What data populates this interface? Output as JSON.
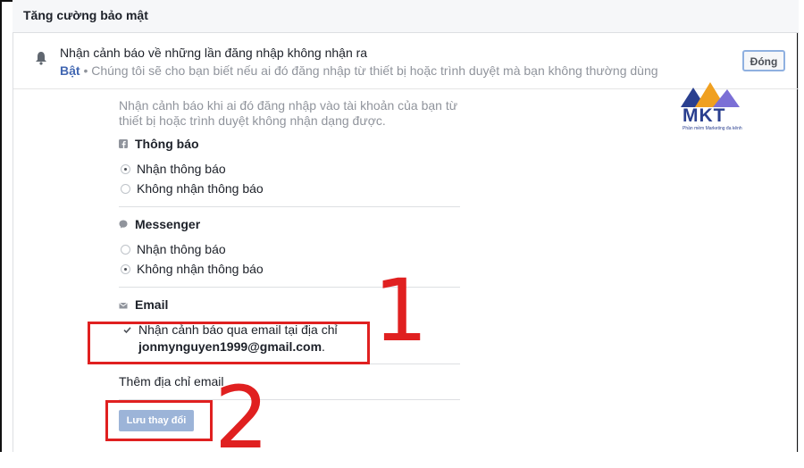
{
  "header": {
    "title": "Tăng cường bảo mật"
  },
  "alert": {
    "title": "Nhận cảnh báo về những lần đăng nhập không nhận ra",
    "status": "Bật",
    "separator": "•",
    "summary": "Chúng tôi sẽ cho bạn biết nếu ai đó đăng nhập từ thiết bị hoặc trình duyệt mà bạn không thường dùng",
    "close_label": "Đóng"
  },
  "description": "Nhận cảnh báo khi ai đó đăng nhập vào tài khoản của bạn từ thiết bị hoặc trình duyệt không nhận dạng được.",
  "notifications": {
    "title": "Thông báo",
    "options": [
      "Nhận thông báo",
      "Không nhận thông báo"
    ],
    "selected": 0
  },
  "messenger": {
    "title": "Messenger",
    "options": [
      "Nhận thông báo",
      "Không nhận thông báo"
    ],
    "selected": 1
  },
  "email": {
    "title": "Email",
    "checkbox_label": "Nhận cảnh báo qua email tại địa chỉ",
    "address": "jonmynguyen1999@gmail.com",
    "address_suffix": ".",
    "checked": true,
    "add_link": "Thêm địa chỉ email"
  },
  "save_label": "Lưu thay đổi",
  "annotations": {
    "step1": "1",
    "step2": "2"
  },
  "logo": {
    "text": "MKT",
    "tagline": "Phần mềm Marketing đa kênh"
  },
  "colors": {
    "accent": "#4267b2",
    "annotation": "#e02020",
    "save_button": "#9cb4d8"
  }
}
